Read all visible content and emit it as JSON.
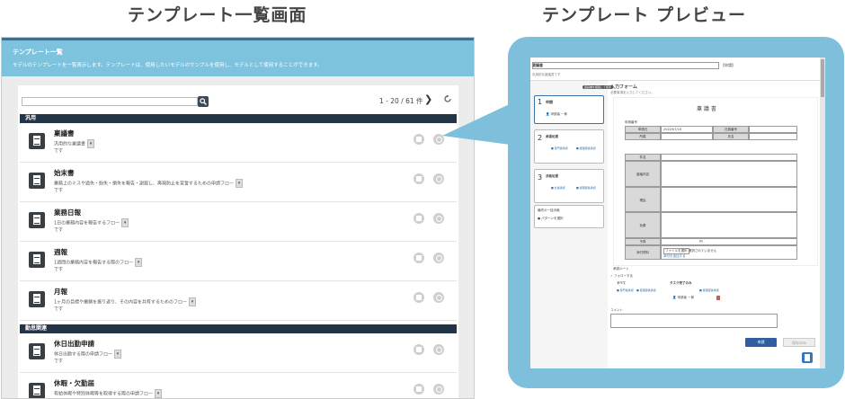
{
  "headings": {
    "left": "テンプレート一覧画面",
    "right": "テンプレート プレビュー"
  },
  "list": {
    "title": "テンプレート一覧",
    "description": "モデルのテンプレートを一覧表示します。テンプレートは、使用したいモデルのサンプルを使用し、モデルとして使用することができます。",
    "search_placeholder": "",
    "pager": "1 - 20 / 61 件",
    "next_symbol": "❯",
    "sections": [
      {
        "label": "汎用",
        "rows": [
          {
            "name": "稟議書",
            "desc1": "汎用的な稟議書",
            "desc2": "です"
          },
          {
            "name": "始末書",
            "desc1": "業務上のミスや過失・紛失・損失を報告・謝罪し、再発防止を宣誓するための申請フロー",
            "desc2": "です"
          },
          {
            "name": "業務日報",
            "desc1": "1日の業務内容を報告するフロー",
            "desc2": "です"
          },
          {
            "name": "週報",
            "desc1": "1週間の業務内容を報告する際のフロー",
            "desc2": "です"
          },
          {
            "name": "月報",
            "desc1": "1ヶ月の目標や業績を振り返り、その内容を共有するためのフロー",
            "desc2": "です"
          }
        ]
      },
      {
        "label": "勤怠関連",
        "rows": [
          {
            "name": "休日出勤申請",
            "desc1": "休日出勤する際の申請フロー",
            "desc2": "です"
          },
          {
            "name": "休暇・欠勤届",
            "desc1": "有給休暇や特別休暇等を取得する際の申請フロー",
            "desc2": "です"
          }
        ]
      }
    ]
  },
  "preview": {
    "name_label": "稟議書",
    "apply_label": "【申請】",
    "sub_note": "汎用的な稟議書です",
    "side_button": "稟議書を複製して使用",
    "steps": [
      {
        "num": "1",
        "title": "申請",
        "user": "申請者 一郎"
      },
      {
        "num": "2",
        "title": "承認処理",
        "a": "■ 部門長承認",
        "b": "■ 経理部長承認"
      },
      {
        "num": "3",
        "title": "決裁処理",
        "a": "■ 社長承認",
        "b": "■ 経理部長承認"
      }
    ],
    "closing_title": "最終の一括決裁",
    "closing_note": "● パターンを選択",
    "form_title": "入力フォーム",
    "form_note": "必要事項を入力してください。",
    "doc_title": "稟 議 書",
    "doc_no_label": "申請番号",
    "apply_date_label": "申請日",
    "apply_date_value": "2022/07/15",
    "dept_label": "所属",
    "staff_no_label": "社員番号",
    "name_field_label": "氏名",
    "subject_label": "件名",
    "content_label": "稟議内容",
    "reason_label": "理由",
    "effect_label": "効果",
    "amount_label": "予算",
    "amount_unit": "円",
    "attach_label": "添付資料",
    "attach_button": "ファイルを選択",
    "attach_status": "選択されていません",
    "attach_link": "添付を追加する",
    "route_title": "承認ルート",
    "follow_label": "フォローする",
    "all_label": "すべて",
    "task_label": "タスク完了のみ",
    "chip_a": "■ 部門長承認",
    "chip_b": "■ 経理部長承認",
    "route_user": "申請者 一郎",
    "comment_label": "コメント",
    "submit": "申請",
    "draft": "保存のみ"
  }
}
